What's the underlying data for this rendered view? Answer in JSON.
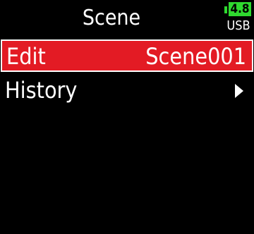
{
  "header": {
    "title": "Scene",
    "battery_level": "4.8",
    "battery_source": "USB"
  },
  "menu": {
    "items": [
      {
        "label": "Edit",
        "value": "Scene001",
        "selected": true
      },
      {
        "label": "History",
        "icon": "chevron-right-icon",
        "selected": false
      }
    ]
  },
  "colors": {
    "background": "#000000",
    "highlight": "#e31b24",
    "battery": "#2fd92f",
    "text": "#ffffff"
  }
}
